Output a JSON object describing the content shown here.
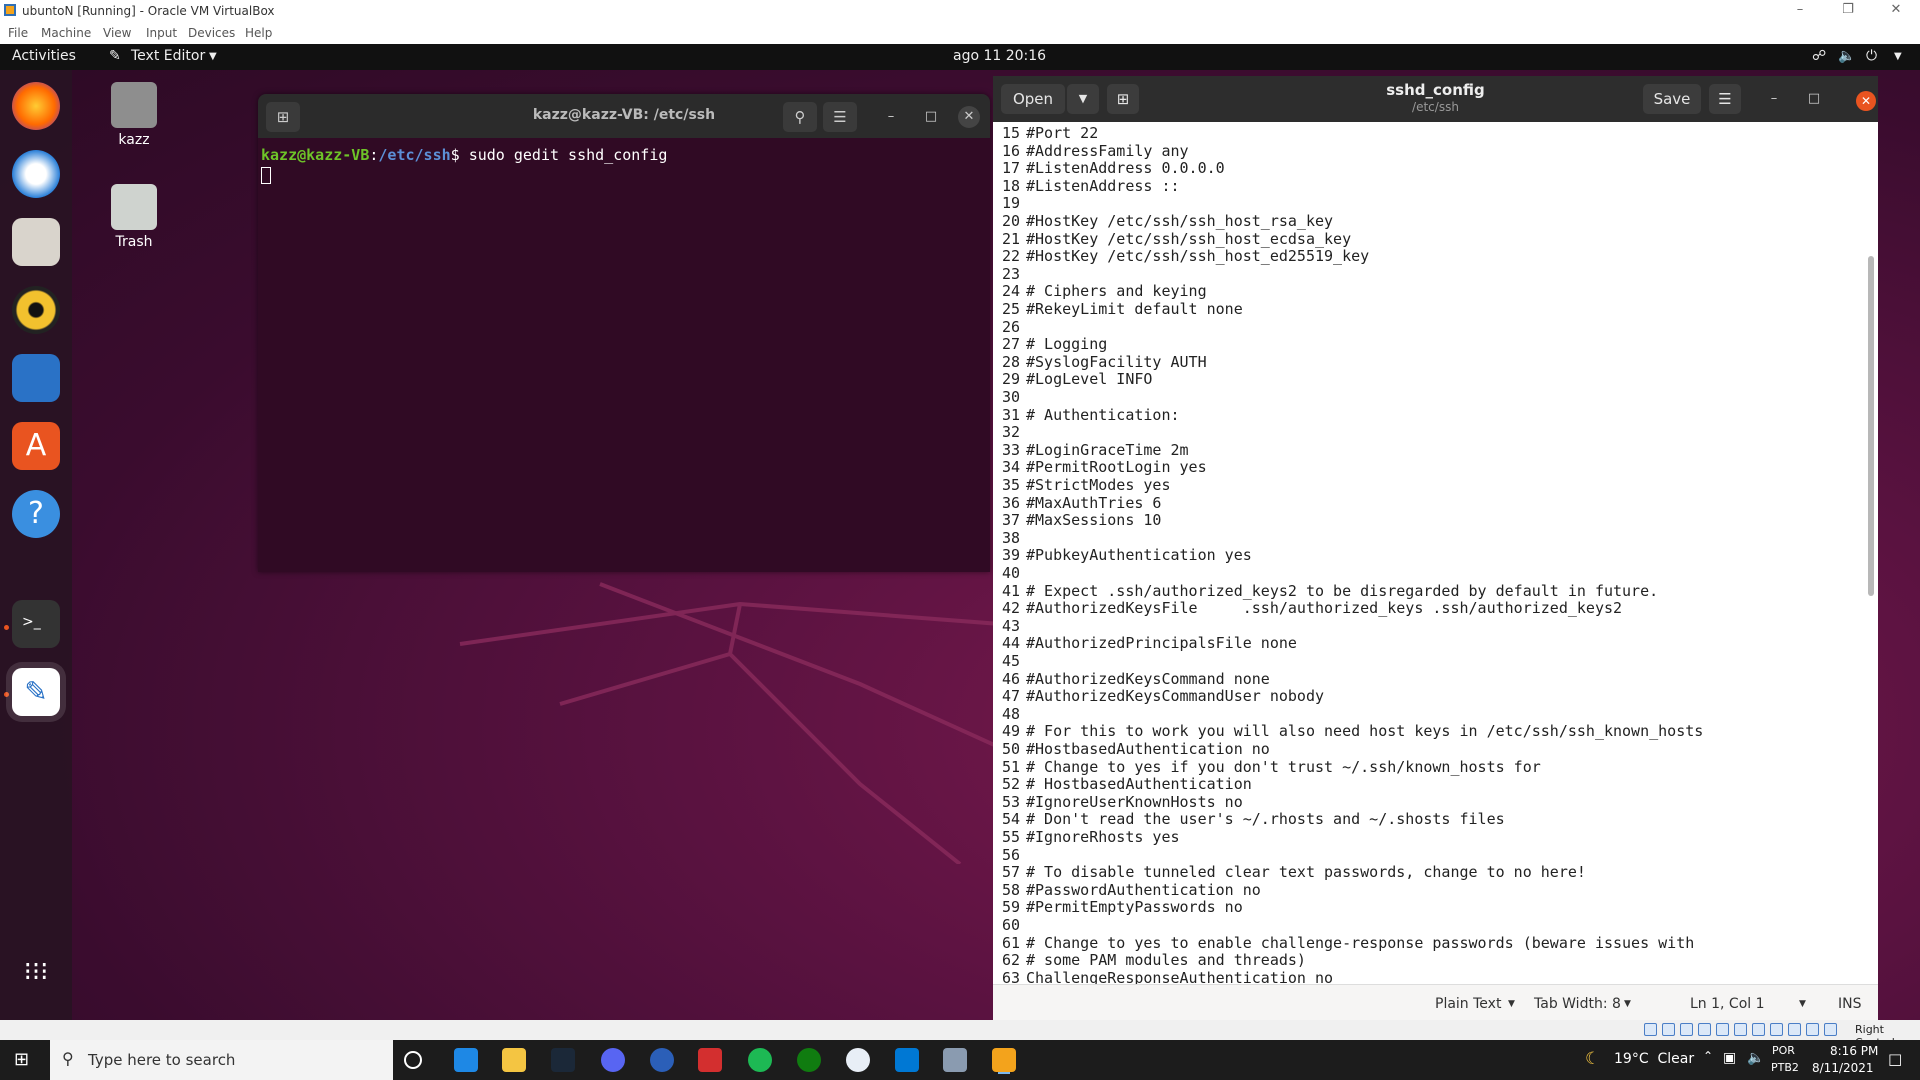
{
  "vbox": {
    "title": "ubuntoN [Running] - Oracle VM VirtualBox",
    "menu": [
      "File",
      "Machine",
      "View",
      "Input",
      "Devices",
      "Help"
    ],
    "right_control": "Right Control"
  },
  "topbar": {
    "activities": "Activities",
    "app_menu": "Text Editor",
    "clock": "ago 11  20:16"
  },
  "desktop": {
    "home_label": "kazz",
    "trash_label": "Trash"
  },
  "terminal": {
    "title": "kazz@kazz-VB: /etc/ssh",
    "prompt_user": "kazz@kazz-VB",
    "prompt_sep": ":",
    "prompt_path": "/etc/ssh",
    "prompt_dollar": "$ ",
    "command": "sudo gedit sshd_config"
  },
  "gedit": {
    "open_label": "Open",
    "save_label": "Save",
    "doc_title": "sshd_config",
    "doc_path": "/etc/ssh",
    "lines": [
      {
        "n": "15",
        "t": "#Port 22"
      },
      {
        "n": "16",
        "t": "#AddressFamily any"
      },
      {
        "n": "17",
        "t": "#ListenAddress 0.0.0.0"
      },
      {
        "n": "18",
        "t": "#ListenAddress ::"
      },
      {
        "n": "19",
        "t": ""
      },
      {
        "n": "20",
        "t": "#HostKey /etc/ssh/ssh_host_rsa_key"
      },
      {
        "n": "21",
        "t": "#HostKey /etc/ssh/ssh_host_ecdsa_key"
      },
      {
        "n": "22",
        "t": "#HostKey /etc/ssh/ssh_host_ed25519_key"
      },
      {
        "n": "23",
        "t": ""
      },
      {
        "n": "24",
        "t": "# Ciphers and keying"
      },
      {
        "n": "25",
        "t": "#RekeyLimit default none"
      },
      {
        "n": "26",
        "t": ""
      },
      {
        "n": "27",
        "t": "# Logging"
      },
      {
        "n": "28",
        "t": "#SyslogFacility AUTH"
      },
      {
        "n": "29",
        "t": "#LogLevel INFO"
      },
      {
        "n": "30",
        "t": ""
      },
      {
        "n": "31",
        "t": "# Authentication:"
      },
      {
        "n": "32",
        "t": ""
      },
      {
        "n": "33",
        "t": "#LoginGraceTime 2m"
      },
      {
        "n": "34",
        "t": "#PermitRootLogin yes"
      },
      {
        "n": "35",
        "t": "#StrictModes yes"
      },
      {
        "n": "36",
        "t": "#MaxAuthTries 6"
      },
      {
        "n": "37",
        "t": "#MaxSessions 10"
      },
      {
        "n": "38",
        "t": ""
      },
      {
        "n": "39",
        "t": "#PubkeyAuthentication yes"
      },
      {
        "n": "40",
        "t": ""
      },
      {
        "n": "41",
        "t": "# Expect .ssh/authorized_keys2 to be disregarded by default in future."
      },
      {
        "n": "42",
        "t": "#AuthorizedKeysFile     .ssh/authorized_keys .ssh/authorized_keys2"
      },
      {
        "n": "43",
        "t": ""
      },
      {
        "n": "44",
        "t": "#AuthorizedPrincipalsFile none"
      },
      {
        "n": "45",
        "t": ""
      },
      {
        "n": "46",
        "t": "#AuthorizedKeysCommand none"
      },
      {
        "n": "47",
        "t": "#AuthorizedKeysCommandUser nobody"
      },
      {
        "n": "48",
        "t": ""
      },
      {
        "n": "49",
        "t": "# For this to work you will also need host keys in /etc/ssh/ssh_known_hosts"
      },
      {
        "n": "50",
        "t": "#HostbasedAuthentication no"
      },
      {
        "n": "51",
        "t": "# Change to yes if you don't trust ~/.ssh/known_hosts for"
      },
      {
        "n": "52",
        "t": "# HostbasedAuthentication"
      },
      {
        "n": "53",
        "t": "#IgnoreUserKnownHosts no"
      },
      {
        "n": "54",
        "t": "# Don't read the user's ~/.rhosts and ~/.shosts files"
      },
      {
        "n": "55",
        "t": "#IgnoreRhosts yes"
      },
      {
        "n": "56",
        "t": ""
      },
      {
        "n": "57",
        "t": "# To disable tunneled clear text passwords, change to no here!"
      },
      {
        "n": "58",
        "t": "#PasswordAuthentication no"
      },
      {
        "n": "59",
        "t": "#PermitEmptyPasswords no"
      },
      {
        "n": "60",
        "t": ""
      },
      {
        "n": "61",
        "t": "# Change to yes to enable challenge-response passwords (beware issues with"
      },
      {
        "n": "62",
        "t": "# some PAM modules and threads)"
      },
      {
        "n": "63",
        "t": "ChallengeResponseAuthentication no"
      }
    ],
    "status": {
      "language": "Plain Text",
      "tab_width": "Tab Width: 8",
      "position": "Ln 1, Col 1",
      "mode": "INS"
    }
  },
  "taskbar": {
    "search_placeholder": "Type here to search",
    "weather": "19°C  Clear",
    "lang": "POR",
    "layout": "PTB2",
    "time": "8:16 PM",
    "date": "8/11/2021"
  },
  "colors": {
    "ubuntu_orange": "#e95420",
    "terminal_bg": "#300a24"
  }
}
